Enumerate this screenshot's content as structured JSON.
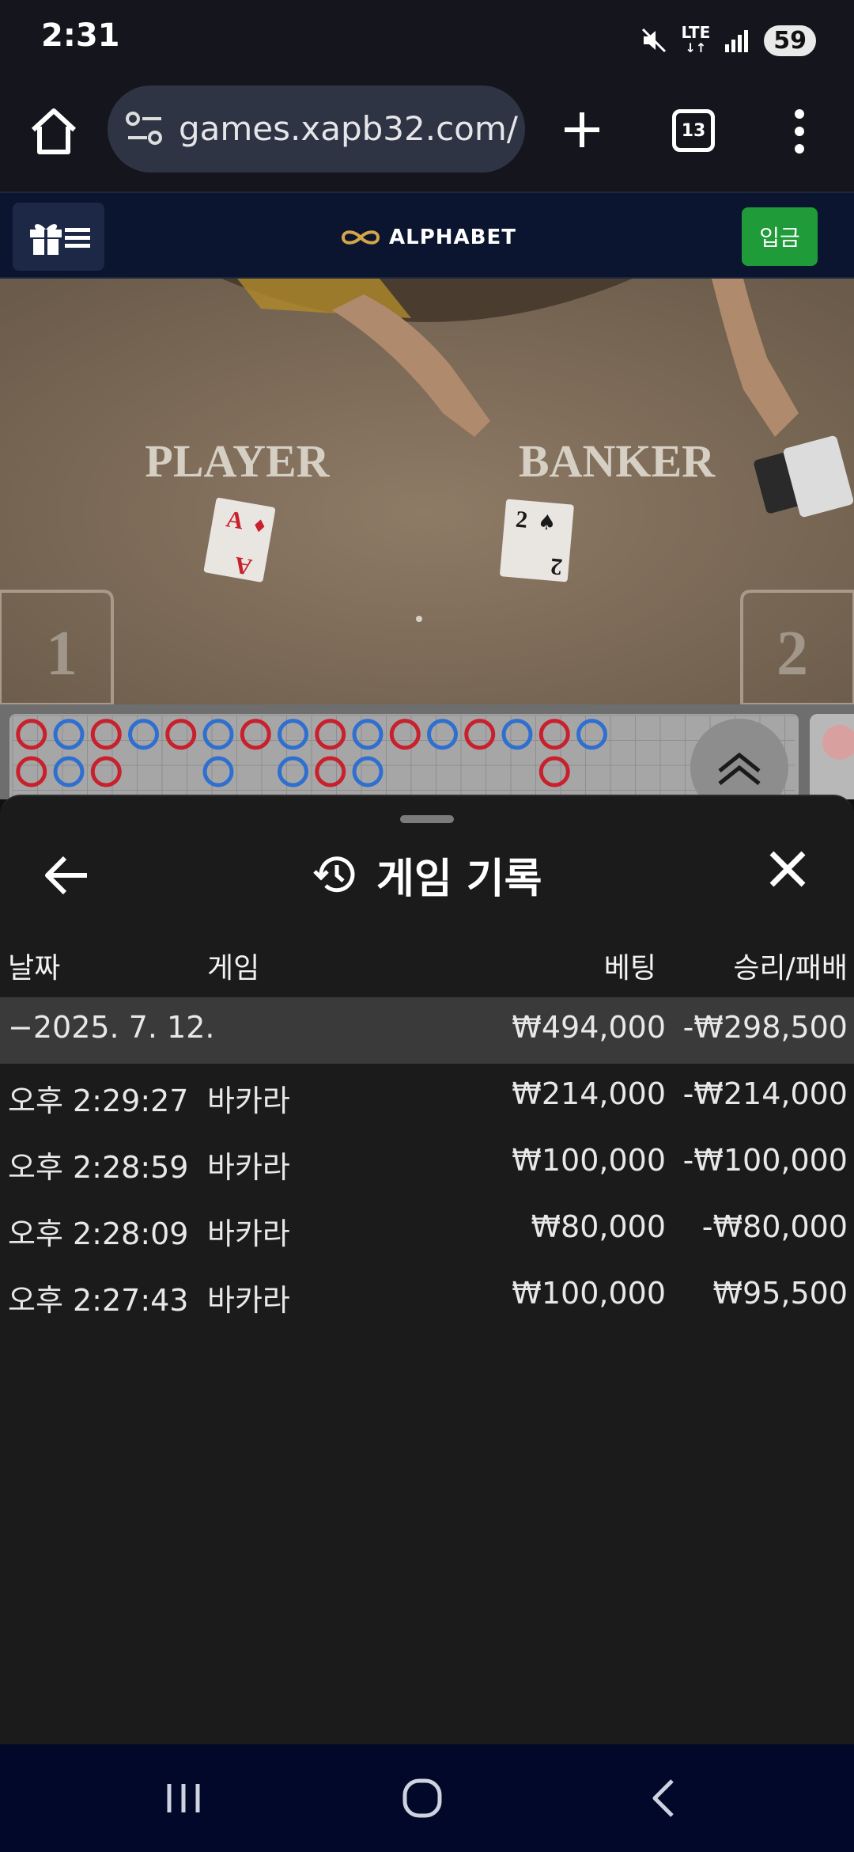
{
  "status_bar": {
    "time": "2:31",
    "network": "LTE",
    "battery": "59"
  },
  "browser": {
    "url": "games.xapb32.com/",
    "tab_count": "13"
  },
  "site": {
    "logo_text": "ALPHABET",
    "deposit_label": "입금"
  },
  "video": {
    "player_label": "PLAYER",
    "banker_label": "BANKER",
    "seat_left": "1",
    "seat_right": "2"
  },
  "history": {
    "title": "게임 기록",
    "columns": {
      "date": "날짜",
      "game": "게임",
      "bet": "베팅",
      "win_loss": "승리/패배"
    },
    "date_group": {
      "date": "−2025. 7. 12.",
      "bet": "₩494,000",
      "win_loss": "-₩298,500"
    },
    "rows": [
      {
        "time": "오후 2:29:27",
        "game": "바카라",
        "bet": "₩214,000",
        "win_loss": "-₩214,000"
      },
      {
        "time": "오후 2:28:59",
        "game": "바카라",
        "bet": "₩100,000",
        "win_loss": "-₩100,000"
      },
      {
        "time": "오후 2:28:09",
        "game": "바카라",
        "bet": "₩80,000",
        "win_loss": "-₩80,000"
      },
      {
        "time": "오후 2:27:43",
        "game": "바카라",
        "bet": "₩100,000",
        "win_loss": "₩95,500"
      }
    ]
  },
  "colors": {
    "deposit_green": "#1f9b3a",
    "banker_red": "#c8202c",
    "player_blue": "#2f6fd0",
    "sheet_bg": "#1b1b1b"
  }
}
